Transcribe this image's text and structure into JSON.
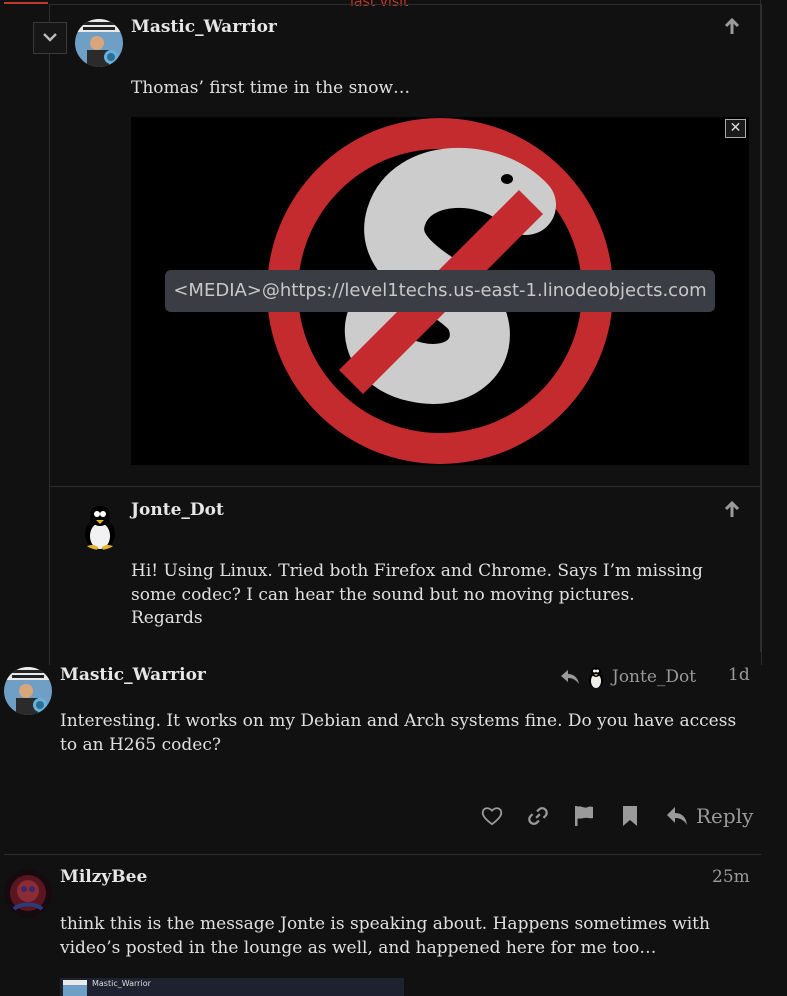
{
  "divider": {
    "last_visit": "last visit"
  },
  "embedded_post": {
    "author": "Mastic_Warrior",
    "text": "Thomas’ first time in the snow…",
    "media_label": "<MEDIA>@https://level1techs.us-east-1.linodeobjects.com",
    "close_glyph": "✕"
  },
  "reply_to_post": {
    "author": "Jonte_Dot",
    "text_lines": [
      "Hi! Using Linux. Tried both Firefox and Chrome. Says I’m missing",
      "some codec? I can hear the sound but no moving pictures.",
      "Regards"
    ]
  },
  "main_post": {
    "author": "Mastic_Warrior",
    "reply_to_name": "Jonte_Dot",
    "age": "1d",
    "text_lines": [
      "Interesting. It works on my Debian and Arch systems fine. Do you have access",
      "to an H265 codec?"
    ],
    "actions": {
      "like_icon": "heart-icon",
      "link_icon": "link-icon",
      "flag_icon": "flag-icon",
      "bookmark_icon": "bookmark-icon",
      "reply_label": "Reply"
    }
  },
  "next_post": {
    "author": "MilzyBee",
    "age": "25m",
    "text_lines": [
      "think this is the message Jonte is speaking about. Happens sometimes with",
      "video’s posted in the lounge as well, and happened here for me too…"
    ],
    "thumb_author": "Mastic_Warrior"
  },
  "colors": {
    "background": "#111111",
    "accent_red": "#c0392b",
    "text": "#e0e0e0",
    "muted": "#9a9a9a"
  }
}
